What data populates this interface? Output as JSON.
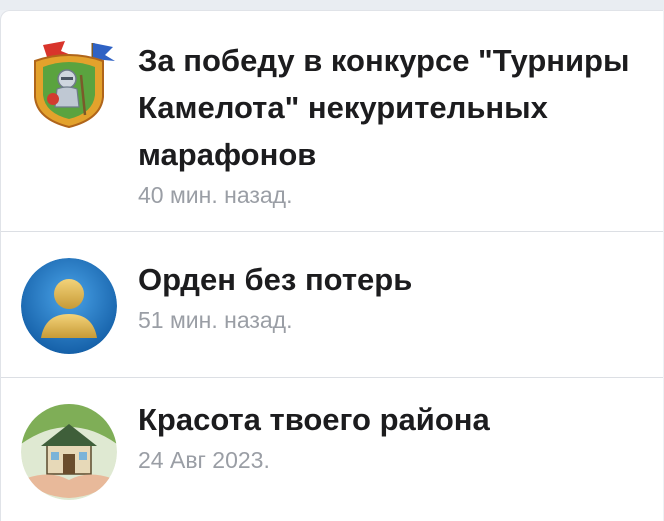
{
  "achievements": [
    {
      "title": "За победу в конкурсе \"Турниры Камелота\" некурительных марафонов",
      "time": "40 мин. назад.",
      "icon": "knight-shield-icon",
      "accent": "#3f7f3a"
    },
    {
      "title": "Орден без потерь",
      "time": "51 мин. назад.",
      "icon": "user-silhouette-icon",
      "accent": "#1f78c8"
    },
    {
      "title": "Красота твоего района",
      "time": "24 Авг 2023.",
      "icon": "house-in-hands-icon",
      "accent": "#5c8f3a"
    }
  ]
}
